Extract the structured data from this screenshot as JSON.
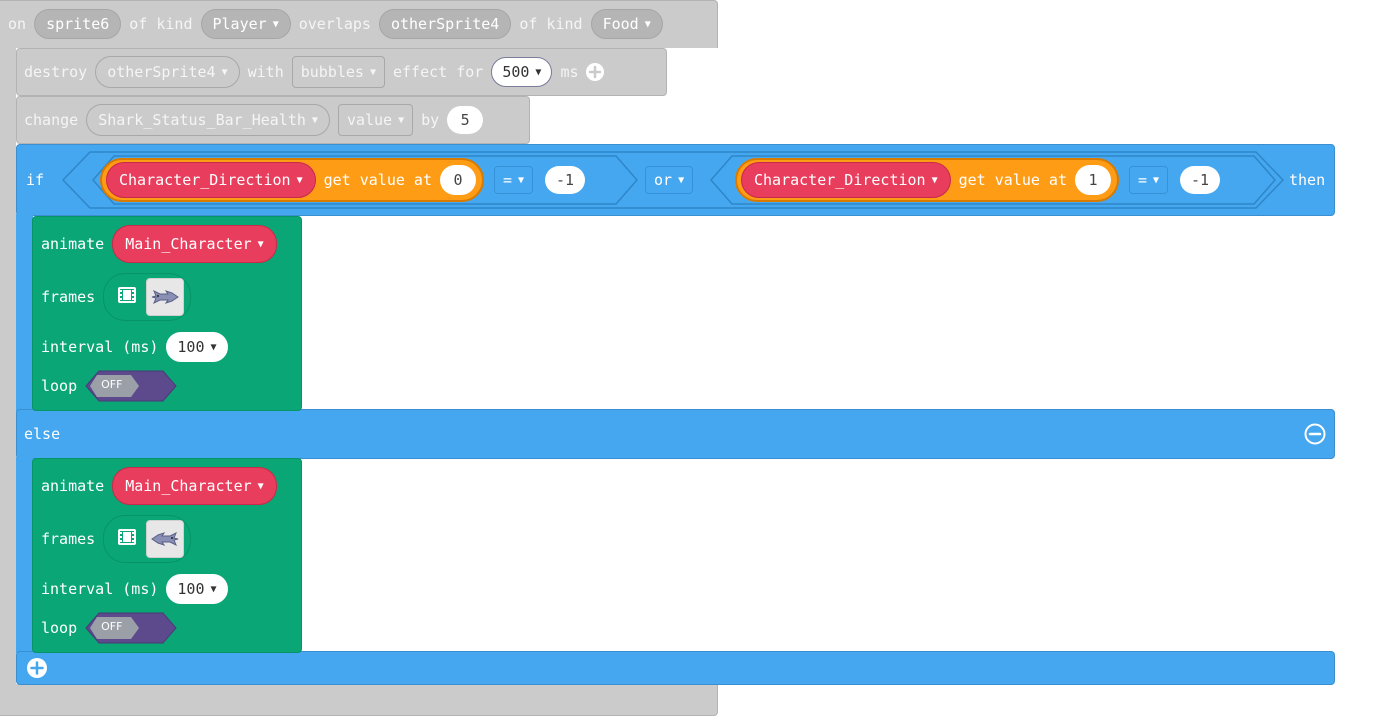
{
  "event": {
    "on": "on",
    "sprite_var": "sprite6",
    "of_kind_1": "of kind",
    "kind1": "Player",
    "overlaps": "overlaps",
    "other_var": "otherSprite4",
    "of_kind_2": "of kind",
    "kind2": "Food"
  },
  "destroy": {
    "label": "destroy",
    "target": "otherSprite4",
    "with": "with",
    "effect": "bubbles",
    "effect_for": "effect for",
    "duration": "500",
    "unit": "ms"
  },
  "change": {
    "label": "change",
    "target": "Shark_Status_Bar_Health",
    "field": "value",
    "by": "by",
    "amount": "5"
  },
  "if_block": {
    "if": "if",
    "then": "then",
    "else": "else",
    "or": "or",
    "left": {
      "var": "Character_Direction",
      "get_value_at": "get value at",
      "index": "0",
      "op": "=",
      "compare": "-1"
    },
    "right": {
      "var": "Character_Direction",
      "get_value_at": "get value at",
      "index": "1",
      "op": "=",
      "compare": "-1"
    }
  },
  "animate_then": {
    "animate": "animate",
    "sprite": "Main_Character",
    "frames": "frames",
    "interval_label": "interval (ms)",
    "interval": "100",
    "loop": "loop",
    "loop_state": "OFF"
  },
  "animate_else": {
    "animate": "animate",
    "sprite": "Main_Character",
    "frames": "frames",
    "interval_label": "interval (ms)",
    "interval": "100",
    "loop": "loop",
    "loop_state": "OFF"
  },
  "colors": {
    "events_grey": "#cbcbcb",
    "logic_blue": "#45a7ef",
    "arrays_orange": "#ff9c15",
    "variable_red": "#e83d5c",
    "animation_green": "#0aa676",
    "toggle_purple": "#5c4a8c"
  },
  "icons": [
    "caret-down-icon",
    "plus-icon",
    "minus-icon",
    "film-icon",
    "shark-sprite-icon"
  ]
}
